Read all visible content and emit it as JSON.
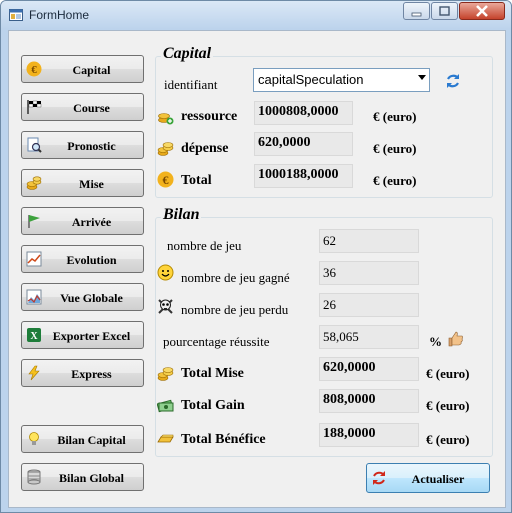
{
  "window": {
    "title": "FormHome"
  },
  "nav": {
    "capital": "Capital",
    "course": "Course",
    "pronostic": "Pronostic",
    "mise": "Mise",
    "arrivee": "Arrivée",
    "evolution": "Evolution",
    "vue_globale": "Vue Globale",
    "exporter_excel": "Exporter Excel",
    "express": "Express",
    "bilan_capital": "Bilan Capital",
    "bilan_global": "Bilan Global"
  },
  "capital": {
    "title": "Capital",
    "identifiant_label": "identifiant",
    "identifiant_value": "capitalSpeculation",
    "ressource_label": "ressource",
    "ressource_value": "1000808,0000",
    "depense_label": "dépense",
    "depense_value": "620,0000",
    "total_label": "Total",
    "total_value": "1000188,0000",
    "unit": "€ (euro)"
  },
  "bilan": {
    "title": "Bilan",
    "nombre_jeu_label": "nombre de jeu",
    "nombre_jeu_value": "62",
    "gagne_label": "nombre de jeu gagné",
    "gagne_value": "36",
    "perdu_label": "nombre de jeu perdu",
    "perdu_value": "26",
    "pourcentage_label": "pourcentage réussite",
    "pourcentage_value": "58,065",
    "pourcentage_unit": "%",
    "total_mise_label": "Total Mise",
    "total_mise_value": "620,0000",
    "total_gain_label": "Total Gain",
    "total_gain_value": "808,0000",
    "total_benefice_label": "Total Bénéfice",
    "total_benefice_value": "188,0000",
    "unit": "€ (euro)"
  },
  "actualiser": "Actualiser"
}
